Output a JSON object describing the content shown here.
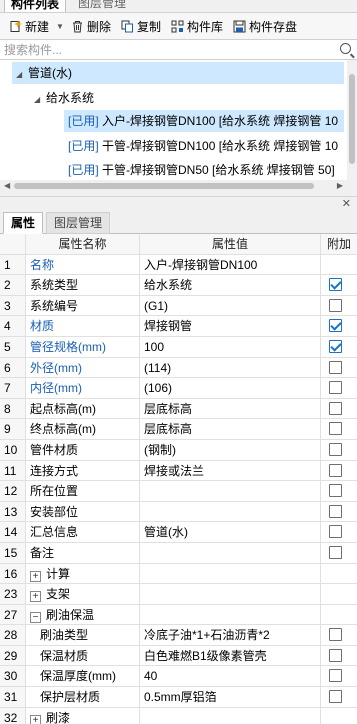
{
  "panels": {
    "top_tabs": [
      "构件列表",
      "图层管理"
    ],
    "bottom_tabs": [
      "属性",
      "图层管理"
    ]
  },
  "toolbar": {
    "new_label": "新建",
    "delete_label": "删除",
    "copy_label": "复制",
    "library_label": "构件库",
    "save_label": "构件存盘"
  },
  "search": {
    "placeholder": "搜索构件..."
  },
  "tree": {
    "root": "管道(水)",
    "group": "给水系统",
    "items": [
      {
        "tag": "[已用]",
        "label": "入户-焊接钢管DN100 [给水系统 焊接钢管 10"
      },
      {
        "tag": "[已用]",
        "label": "干管-焊接钢管DN100 [给水系统 焊接钢管 10"
      },
      {
        "tag": "[已用]",
        "label": "干管-焊接钢管DN50 [给水系统 焊接钢管 50]"
      }
    ]
  },
  "grid": {
    "headers": {
      "name": "属性名称",
      "value": "属性值",
      "add": "附加"
    },
    "rows": [
      {
        "num": "1",
        "name": "名称",
        "value": "入户-焊接钢管DN100",
        "blue": true,
        "cb": "none"
      },
      {
        "num": "2",
        "name": "系统类型",
        "value": "给水系统",
        "blue": false,
        "cb": "checked"
      },
      {
        "num": "3",
        "name": "系统编号",
        "value": "(G1)",
        "blue": false,
        "cb": "unchecked"
      },
      {
        "num": "4",
        "name": "材质",
        "value": "焊接钢管",
        "blue": true,
        "cb": "checked"
      },
      {
        "num": "5",
        "name": "管径规格(mm)",
        "value": "100",
        "blue": true,
        "cb": "checked"
      },
      {
        "num": "6",
        "name": "外径(mm)",
        "value": "(114)",
        "blue": true,
        "cb": "unchecked"
      },
      {
        "num": "7",
        "name": "内径(mm)",
        "value": "(106)",
        "blue": true,
        "cb": "unchecked"
      },
      {
        "num": "8",
        "name": "起点标高(m)",
        "value": "层底标高",
        "blue": false,
        "cb": "unchecked"
      },
      {
        "num": "9",
        "name": "终点标高(m)",
        "value": "层底标高",
        "blue": false,
        "cb": "unchecked"
      },
      {
        "num": "10",
        "name": "管件材质",
        "value": "(钢制)",
        "blue": false,
        "cb": "unchecked"
      },
      {
        "num": "11",
        "name": "连接方式",
        "value": "焊接或法兰",
        "blue": false,
        "cb": "unchecked"
      },
      {
        "num": "12",
        "name": "所在位置",
        "value": "",
        "blue": false,
        "cb": "unchecked"
      },
      {
        "num": "13",
        "name": "安装部位",
        "value": "",
        "blue": false,
        "cb": "unchecked"
      },
      {
        "num": "14",
        "name": "汇总信息",
        "value": "管道(水)",
        "blue": false,
        "cb": "unchecked"
      },
      {
        "num": "15",
        "name": "备注",
        "value": "",
        "blue": false,
        "cb": "unchecked"
      },
      {
        "num": "16",
        "name": "计算",
        "value": "",
        "blue": false,
        "cb": "none",
        "expander": "+"
      },
      {
        "num": "23",
        "name": "支架",
        "value": "",
        "blue": false,
        "cb": "none",
        "expander": "+"
      },
      {
        "num": "27",
        "name": "刷油保温",
        "value": "",
        "blue": false,
        "cb": "none",
        "expander": "−"
      },
      {
        "num": "28",
        "name": "刷油类型",
        "value": "冷底子油*1+石油沥青*2",
        "blue": false,
        "cb": "unchecked",
        "child": true
      },
      {
        "num": "29",
        "name": "保温材质",
        "value": "白色难燃B1级像素管壳",
        "blue": false,
        "cb": "unchecked",
        "child": true
      },
      {
        "num": "30",
        "name": "保温厚度(mm)",
        "value": "40",
        "blue": false,
        "cb": "unchecked",
        "child": true
      },
      {
        "num": "31",
        "name": "保护层材质",
        "value": "0.5mm厚铝箔",
        "blue": false,
        "cb": "unchecked",
        "child": true
      },
      {
        "num": "32",
        "name": "刷漆",
        "value": "",
        "blue": false,
        "cb": "none",
        "expander": "+"
      }
    ]
  }
}
